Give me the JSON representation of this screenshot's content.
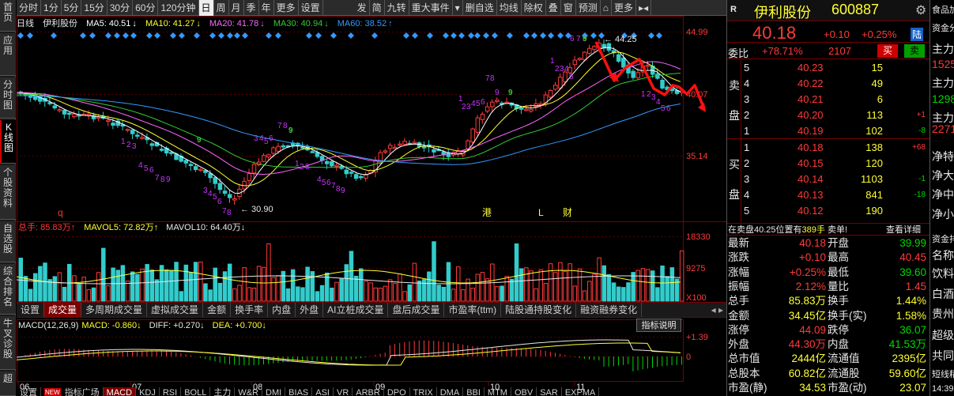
{
  "left_nav": [
    {
      "label": "首页",
      "active": false
    },
    {
      "label": "应用",
      "active": false
    },
    {
      "label": "分时图",
      "active": false
    },
    {
      "label": "K线图",
      "active": true
    },
    {
      "label": "个股资料",
      "active": false
    },
    {
      "label": "自选股",
      "active": false
    },
    {
      "label": "综合排名",
      "active": false
    },
    {
      "label": "牛叉诊股",
      "active": false
    },
    {
      "label": "超",
      "active": false
    }
  ],
  "toolbar": {
    "periods": [
      "分时",
      "1分",
      "5分",
      "15分",
      "30分",
      "60分",
      "120分钟",
      "日",
      "周",
      "月",
      "季",
      "年",
      "更多",
      "设置"
    ],
    "active_period": "日",
    "tools": [
      "发",
      "简",
      "九转",
      "重大事件",
      "▾",
      "删自选",
      "均线",
      "除权",
      "叠",
      "窗",
      "预测",
      "⌂",
      "更多",
      "▸◂"
    ]
  },
  "main_legend": {
    "type": "日线",
    "name": "伊利股份",
    "ma5": "MA5: 40.51",
    "ma10": "MA10: 41.27",
    "ma20": "MA20: 41.78",
    "ma30": "MA30: 40.94",
    "ma60": "MA60: 38.52"
  },
  "price_axis": [
    "44.99",
    "40.07",
    "35.14"
  ],
  "price_labels": {
    "high": "44.25",
    "low": "30.90"
  },
  "event_markers": [
    {
      "text": "q",
      "color": "#ff3333"
    },
    {
      "text": "港",
      "color": "#ffff33"
    },
    {
      "text": "L",
      "color": "#ffff33"
    },
    {
      "text": "财",
      "color": "#ffff33"
    }
  ],
  "volume_legend": {
    "label": "总手: 85.83万",
    "mavol5": "MAVOL5: 72.82万",
    "mavol10": "MAVOL10: 64.40万"
  },
  "volume_axis": [
    "18330",
    "9275",
    "X100"
  ],
  "indicator_tabs": [
    "设置",
    "成交量",
    "多周期成交量",
    "虚拟成交量",
    "金额",
    "换手率",
    "内盘",
    "外盘",
    "AI立桩成交量",
    "盘后成交量",
    "市盈率(ttm)",
    "陆股通持股变化",
    "融资融券变化"
  ],
  "active_indicator_tab": "成交量",
  "macd_legend": {
    "label": "MACD(12,26,9)",
    "macd": "MACD: -0.860",
    "diff": "DIFF: +0.270",
    "dea": "DEA: +0.700"
  },
  "indicator_button": "指标说明",
  "macd_axis": [
    "1.39",
    "0"
  ],
  "months": [
    "06",
    "07",
    "08",
    "09",
    "10",
    "11"
  ],
  "bottom_tabs": [
    "设置",
    "指标广场",
    "MACD",
    "KDJ",
    "RSI",
    "BOLL",
    "主力",
    "W&R",
    "DMI",
    "BIAS",
    "ASI",
    "VR",
    "ARBR",
    "DPO",
    "TRIX",
    "DMA",
    "BBI",
    "MTM",
    "OBV",
    "SAR",
    "EXPMA"
  ],
  "bottom_tab_new": "NEW",
  "active_bottom_tab": "MACD",
  "stock": {
    "market": "R",
    "name": "伊利股份",
    "code": "600887",
    "price": "40.18",
    "change": "+0.10",
    "change_pct": "+0.25%",
    "board": "陆",
    "weibi_label": "委比",
    "weibi": "+78.71%",
    "weicha": "2107",
    "buy_btn": "买",
    "sell_btn": "卖"
  },
  "sell_side_label": [
    "卖",
    "盘"
  ],
  "buy_side_label": [
    "买",
    "盘"
  ],
  "asks": [
    {
      "level": "5",
      "price": "40.23",
      "vol": "15",
      "delta": ""
    },
    {
      "level": "4",
      "price": "40.22",
      "vol": "49",
      "delta": ""
    },
    {
      "level": "3",
      "price": "40.21",
      "vol": "6",
      "delta": ""
    },
    {
      "level": "2",
      "price": "40.20",
      "vol": "113",
      "delta": "+1"
    },
    {
      "level": "1",
      "price": "40.19",
      "vol": "102",
      "delta": "-8"
    }
  ],
  "bids": [
    {
      "level": "1",
      "price": "40.18",
      "vol": "138",
      "delta": "+68"
    },
    {
      "level": "2",
      "price": "40.15",
      "vol": "120",
      "delta": ""
    },
    {
      "level": "3",
      "price": "40.14",
      "vol": "1103",
      "delta": "-1"
    },
    {
      "level": "4",
      "price": "40.13",
      "vol": "841",
      "delta": "-18"
    },
    {
      "level": "5",
      "price": "40.12",
      "vol": "190",
      "delta": ""
    }
  ],
  "notice": {
    "text_a": "在卖盘40.25位置有",
    "text_b": "389手",
    "text_c": "卖单!",
    "link": "查看详细"
  },
  "quotes": [
    {
      "l1": "最新",
      "v1": "40.18",
      "c1": "red",
      "l2": "开盘",
      "v2": "39.99",
      "c2": "green"
    },
    {
      "l1": "涨跌",
      "v1": "+0.10",
      "c1": "red",
      "l2": "最高",
      "v2": "40.45",
      "c2": "red"
    },
    {
      "l1": "涨幅",
      "v1": "+0.25%",
      "c1": "red",
      "l2": "最低",
      "v2": "39.60",
      "c2": "green"
    },
    {
      "l1": "振幅",
      "v1": "2.12%",
      "c1": "red",
      "l2": "量比",
      "v2": "1.45",
      "c2": "red"
    },
    {
      "l1": "总手",
      "v1": "85.83万",
      "c1": "yellow",
      "l2": "换手",
      "v2": "1.44%",
      "c2": "yellow"
    },
    {
      "l1": "金额",
      "v1": "34.45亿",
      "c1": "yellow",
      "l2": "换手(实)",
      "v2": "1.58%",
      "c2": "yellow"
    },
    {
      "l1": "涨停",
      "v1": "44.09",
      "c1": "red",
      "l2": "跌停",
      "v2": "36.07",
      "c2": "green"
    },
    {
      "l1": "外盘",
      "v1": "44.30万",
      "c1": "red",
      "l2": "内盘",
      "v2": "41.53万",
      "c2": "green"
    },
    {
      "l1": "总市值",
      "v1": "2444亿",
      "c1": "yellow",
      "l2": "流通值",
      "v2": "2395亿",
      "c2": "yellow"
    },
    {
      "l1": "总股本",
      "v1": "60.82亿",
      "c1": "yellow",
      "l2": "流通股",
      "v2": "59.60亿",
      "c2": "yellow"
    },
    {
      "l1": "市盈(静)",
      "v1": "34.53",
      "c1": "yellow",
      "l2": "市盈(动)",
      "v2": "23.07",
      "c2": "yellow"
    }
  ],
  "far_right": [
    {
      "text": "食品加",
      "color": "#e8e8e8"
    },
    {
      "text": "资金分",
      "color": "#e8e8e8"
    },
    {
      "text": "主力",
      "color": "#e8e8e8"
    },
    {
      "text": "1525",
      "color": "#ff3a3a"
    },
    {
      "text": "主力",
      "color": "#e8e8e8"
    },
    {
      "text": "1298",
      "color": "#00d800"
    },
    {
      "text": "主力",
      "color": "#e8e8e8"
    },
    {
      "text": "2271",
      "color": "#ff3a3a"
    },
    {
      "text": "净特",
      "color": "#e8e8e8"
    },
    {
      "text": "净大",
      "color": "#e8e8e8"
    },
    {
      "text": "净中",
      "color": "#e8e8e8"
    },
    {
      "text": "净小",
      "color": "#e8e8e8"
    },
    {
      "text": "资金排",
      "color": "#e8e8e8"
    },
    {
      "text": "名称",
      "color": "#e8e8e8"
    },
    {
      "text": "饮料",
      "color": "#e8e8e8"
    },
    {
      "text": "白酒",
      "color": "#e8e8e8"
    },
    {
      "text": "贵州",
      "color": "#e8e8e8"
    },
    {
      "text": "超级",
      "color": "#e8e8e8"
    },
    {
      "text": "共同",
      "color": "#e8e8e8"
    },
    {
      "text": "短线精",
      "color": "#e8e8e8"
    },
    {
      "text": "14:39",
      "color": "#e8e8e8"
    }
  ],
  "colors": {
    "up": "#ff3a3a",
    "down": "#33cccc",
    "ma5": "#ffffff",
    "ma10": "#ffff33",
    "ma20": "#ff66ff",
    "ma30": "#33cc33",
    "ma60": "#3399ff",
    "nine_count": "#cc33ff"
  }
}
